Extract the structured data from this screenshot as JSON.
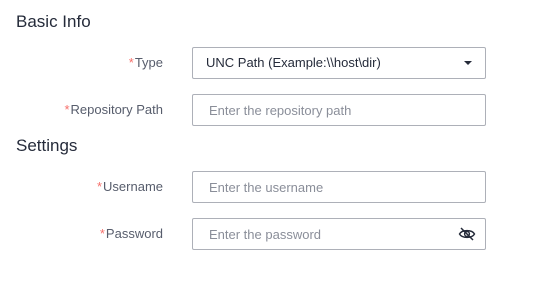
{
  "sections": {
    "basic_info": "Basic Info",
    "settings": "Settings"
  },
  "form": {
    "required_marker": "*",
    "type": {
      "label": "Type",
      "selected": "UNC Path (Example:\\\\host\\dir)",
      "icon": "chevron-down-icon"
    },
    "repository_path": {
      "label": "Repository Path",
      "placeholder": "Enter the repository path",
      "value": ""
    },
    "username": {
      "label": "Username",
      "placeholder": "Enter the username",
      "value": ""
    },
    "password": {
      "label": "Password",
      "placeholder": "Enter the password",
      "value": "",
      "icon": "eye-hidden-icon"
    }
  },
  "colors": {
    "required": "#f66f6a",
    "border": "#adb0b8",
    "label": "#575d6c",
    "placeholder": "#8a8e99"
  }
}
